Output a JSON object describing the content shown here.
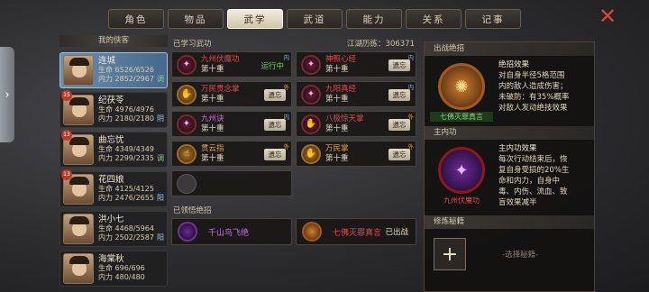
{
  "tabs": [
    "角色",
    "物品",
    "武学",
    "武道",
    "能力",
    "关系",
    "记事"
  ],
  "active_tab": 2,
  "edge_arrow": "›",
  "close_icon": "✕",
  "hero_header": "我的侠客",
  "heroes": [
    {
      "name": "连城",
      "hp": "生命 6526/6526",
      "mp": "内力 2852/2967",
      "tag": "调",
      "badge": ""
    },
    {
      "name": "纪茯苓",
      "hp": "生命 4976/4976",
      "mp": "内力 2180/2180",
      "tag": "阴",
      "badge": "15"
    },
    {
      "name": "曲忘忧",
      "hp": "生命 4349/4349",
      "mp": "内力 2299/2335",
      "tag": "调",
      "badge": "13"
    },
    {
      "name": "花四娘",
      "hp": "生命 4125/4125",
      "mp": "内力 2476/2655",
      "tag": "阳",
      "badge": "13"
    },
    {
      "name": "洪小七",
      "hp": "生命 4468/5964",
      "mp": "内力 2502/2587",
      "tag": "阳",
      "badge": ""
    },
    {
      "name": "海棠秋",
      "hp": "生命 696/696",
      "mp": "内力 480/480",
      "tag": "",
      "badge": ""
    }
  ],
  "learned_title": "已学习武功",
  "jianghu_exp": "江湖历练：306371",
  "skills": [
    {
      "name": "九州伏魔功",
      "level": "第十重",
      "action": "运行中",
      "corner": "内",
      "color": "red"
    },
    {
      "name": "神照心经",
      "level": "第十重",
      "action": "遗忘",
      "corner": "内",
      "color": "red"
    },
    {
      "name": "万民贯念掌",
      "level": "第十重",
      "action": "遗忘",
      "corner": "外",
      "color": "red"
    },
    {
      "name": "九阳真经",
      "level": "第十重",
      "action": "遗忘",
      "corner": "内",
      "color": "red"
    },
    {
      "name": "九州诀",
      "level": "第十重",
      "action": "遗忘",
      "corner": "内",
      "color": "purple"
    },
    {
      "name": "八极惊天掌",
      "level": "第十重",
      "action": "遗忘",
      "corner": "外",
      "color": "red"
    },
    {
      "name": "贯云指",
      "level": "第十重",
      "action": "遗忘",
      "corner": "外",
      "color": "orange"
    },
    {
      "name": "万民掌",
      "level": "第十重",
      "action": "遗忘",
      "corner": "外",
      "color": "orange"
    }
  ],
  "ult_title": "已领悟绝招",
  "ults": [
    {
      "name": "千山鸟飞绝",
      "status": ""
    },
    {
      "name": "七佛灭罪真言",
      "status": "已出战"
    }
  ],
  "right": {
    "battle_title": "出战绝招",
    "battle_effect_title": "绝招效果",
    "battle_effect_lines": [
      "对自身半径5格范围",
      "内的敌人造成伤害；",
      "未破防：有35%概率",
      "对敌人发动绝技效果"
    ],
    "battle_name": "七佛灭罪真言",
    "inner_title": "主内功",
    "inner_effect_title": "主内功效果",
    "inner_effect_lines": [
      "每次行动结束后，恢",
      "复自身受损的20%生",
      "命和内力，自身中",
      "毒、内伤、流血、致",
      "盲效果减半"
    ],
    "inner_name": "九州伏魔功",
    "secret_title": "修炼秘籍",
    "plus": "+",
    "select_hint": "-选择秘籍-"
  }
}
